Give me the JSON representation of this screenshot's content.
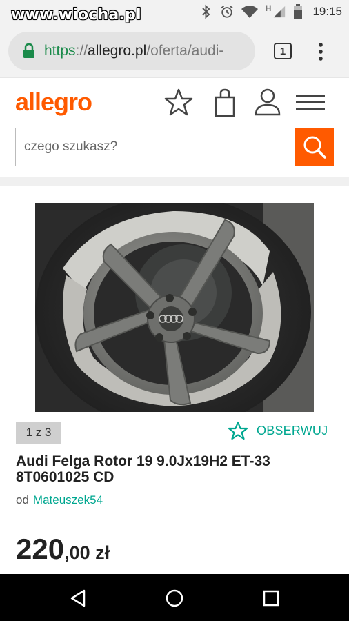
{
  "status_bar": {
    "watermark": "www.wiocha.pl",
    "time": "19:15",
    "network_letter": "H",
    "icons": [
      "bluetooth-icon",
      "alarm-icon",
      "wifi-icon",
      "signal-icon",
      "battery-icon"
    ]
  },
  "browser": {
    "url_scheme": "https",
    "url_sep": "://",
    "url_host": "allegro.pl",
    "url_path": "/oferta/audi-",
    "tab_count": "1"
  },
  "header": {
    "logo": "allegro",
    "search_placeholder": "czego szukasz?"
  },
  "product": {
    "image_counter": "1 z 3",
    "watch_label": "OBSERWUJ",
    "title": "Audi Felga Rotor 19 9.0Jx19H2 ET-33 8T0601025 CD",
    "seller_prefix": "od",
    "seller_name": "Mateuszek54",
    "price_int": "220",
    "price_dec": ",00 zł"
  },
  "navigation": {
    "buttons": [
      "back-icon",
      "home-icon",
      "recents-icon"
    ]
  },
  "colors": {
    "brand": "#ff5a00",
    "accent": "#00a790"
  }
}
